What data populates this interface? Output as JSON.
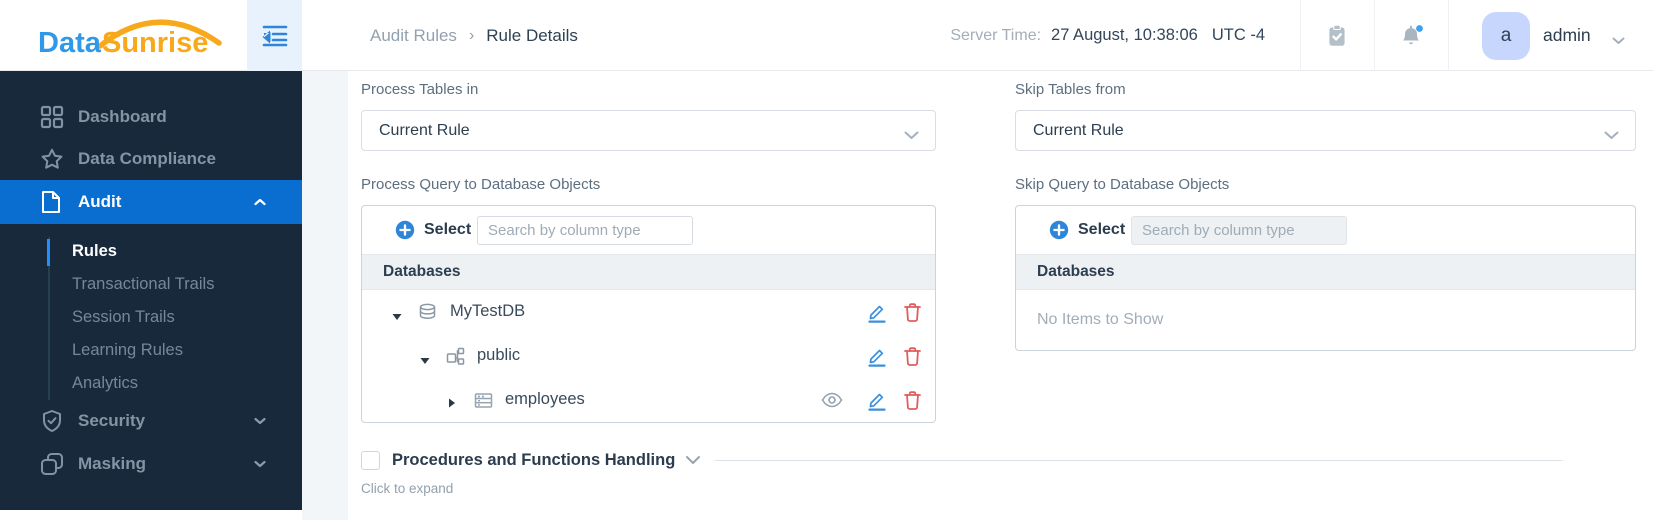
{
  "topbar": {
    "logo_part1": "Data",
    "logo_part2": "Sunrise",
    "breadcrumb": {
      "parent": "Audit Rules",
      "separator": "›",
      "current": "Rule Details"
    },
    "server_time": {
      "label": "Server Time:",
      "value": "27 August, 10:38:06",
      "timezone": "UTC -4"
    },
    "user": {
      "initial": "a",
      "name": "admin"
    }
  },
  "sidebar": {
    "items": [
      {
        "label": "Dashboard"
      },
      {
        "label": "Data Compliance"
      },
      {
        "label": "Audit"
      },
      {
        "label": "Security"
      },
      {
        "label": "Masking"
      }
    ],
    "audit_submenu": [
      {
        "label": "Rules"
      },
      {
        "label": "Transactional Trails"
      },
      {
        "label": "Session Trails"
      },
      {
        "label": "Learning Rules"
      },
      {
        "label": "Analytics"
      }
    ]
  },
  "content": {
    "process_tables_in": {
      "label": "Process Tables in",
      "selected": "Current Rule"
    },
    "skip_tables_from": {
      "label": "Skip Tables from",
      "selected": "Current Rule"
    },
    "process_query": {
      "title": "Process Query to Database Objects",
      "select_button": "Select",
      "search_placeholder": "Search by column type",
      "header": "Databases",
      "tree": [
        {
          "name": "MyTestDB",
          "type": "database"
        },
        {
          "name": "public",
          "type": "schema"
        },
        {
          "name": "employees",
          "type": "table"
        }
      ]
    },
    "skip_query": {
      "title": "Skip Query to Database Objects",
      "select_button": "Select",
      "search_placeholder": "Search by column type",
      "header": "Databases",
      "empty": "No Items to Show"
    },
    "procedures": {
      "label": "Procedures and Functions Handling",
      "hint": "Click to expand"
    }
  },
  "colors": {
    "accent_blue": "#0a6ed1",
    "logo_blue": "#2f99e8",
    "logo_orange": "#f8a91b",
    "sidebar_bg": "#17293a",
    "edit_icon": "#3c8fdc",
    "delete_icon": "#e25d5d",
    "notification_dot": "#3da0f2"
  }
}
